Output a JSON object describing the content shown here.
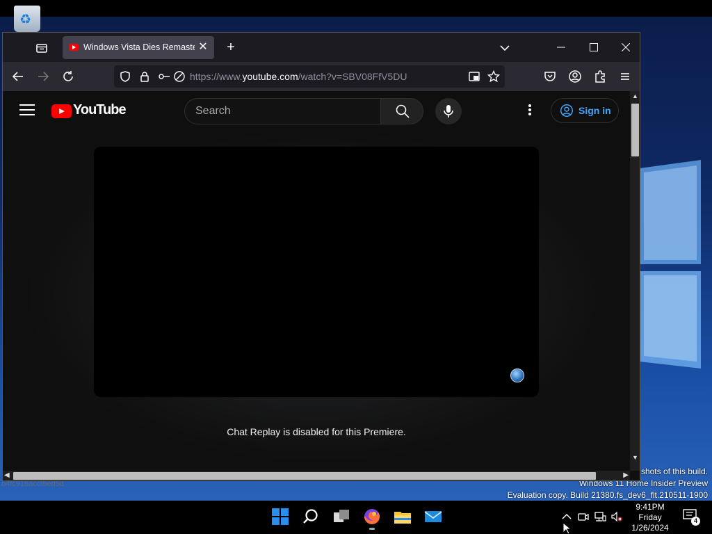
{
  "browser": {
    "tab_title": "Windows Vista Dies Remastered",
    "tab_close": "✕",
    "new_tab": "+",
    "url_prefix": "https://www.",
    "url_domain": "youtube.com",
    "url_path": "/watch?v=SBV08FfV5DU"
  },
  "youtube": {
    "logo_text": "YouTube",
    "search_placeholder": "Search",
    "sign_in": "Sign in",
    "chat_message": "Chat Replay is disabled for this Premiere."
  },
  "desktop": {
    "watermark_line1": "shots of this build.",
    "watermark_line2": "Windows 11 Home Insider Preview",
    "watermark_line3": "Evaluation copy. Build 21380.fs_dev6_flt.210511-1900",
    "hash_text": "b4fc915accf6ed5d"
  },
  "taskbar": {
    "time": "9:41PM",
    "day": "Friday",
    "date": "1/26/2024",
    "notification_count": "4"
  },
  "colors": {
    "youtube_red": "#ff0000",
    "sign_in_blue": "#3ea6ff",
    "firefox_toolbar": "#2b2a33"
  }
}
